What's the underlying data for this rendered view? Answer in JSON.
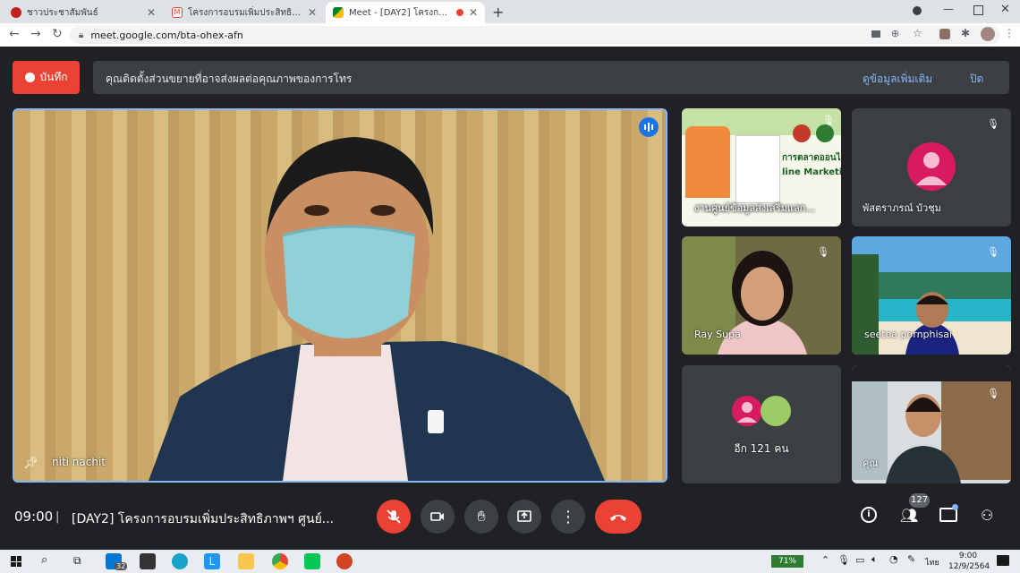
{
  "browser": {
    "tabs": [
      {
        "title": "ชาวประชาสัมพันธ์",
        "favicon_color": "#c5221f"
      },
      {
        "title": "โครงการอบรมเพิ่มประสิทธิภาพฯ ศูนย์ข",
        "favicon_color": "#ea4335"
      },
      {
        "title": "Meet - [DAY2] โครงการอบรมเ",
        "favicon_color": "#00832d"
      }
    ],
    "url": "meet.google.com/bta-ohex-afn"
  },
  "banner": {
    "record_label": "บันทึก",
    "message": "คุณติดตั้งส่วนขยายที่อาจส่งผลต่อคุณภาพของการโทร",
    "more_info": "ดูข้อมูลเพิ่มเติม",
    "close": "ปิด"
  },
  "main_speaker": {
    "name": "niti nachit"
  },
  "participants": [
    {
      "name": "งานศูนย์ข้อมูลส่งเสริมแลก..."
    },
    {
      "name": "พัสตราภรณ์ บัวชุม"
    },
    {
      "name": "Ray Supa"
    },
    {
      "name": "seetoa pornphisai"
    },
    {
      "name": "อีก 121 คน"
    },
    {
      "name": "คุณ"
    }
  ],
  "presentation_text": {
    "line1": "การตลาดออนไลน์",
    "line2": "line Marketin"
  },
  "footer": {
    "time": "09:00",
    "meeting_title": "[DAY2] โครงการอบรมเพิ่มประสิทธิภาพฯ ศูนย์...",
    "participant_count": "127"
  },
  "taskbar": {
    "battery": "71%",
    "lang": "ไทย",
    "clock_time": "9:00",
    "clock_date": "12/9/2564",
    "store_badge": "32"
  },
  "colors": {
    "meet_bg": "#202124",
    "hangup": "#ea4335",
    "accent_link": "#8ab4f8",
    "active_speaker_border": "#8ab4f8"
  }
}
